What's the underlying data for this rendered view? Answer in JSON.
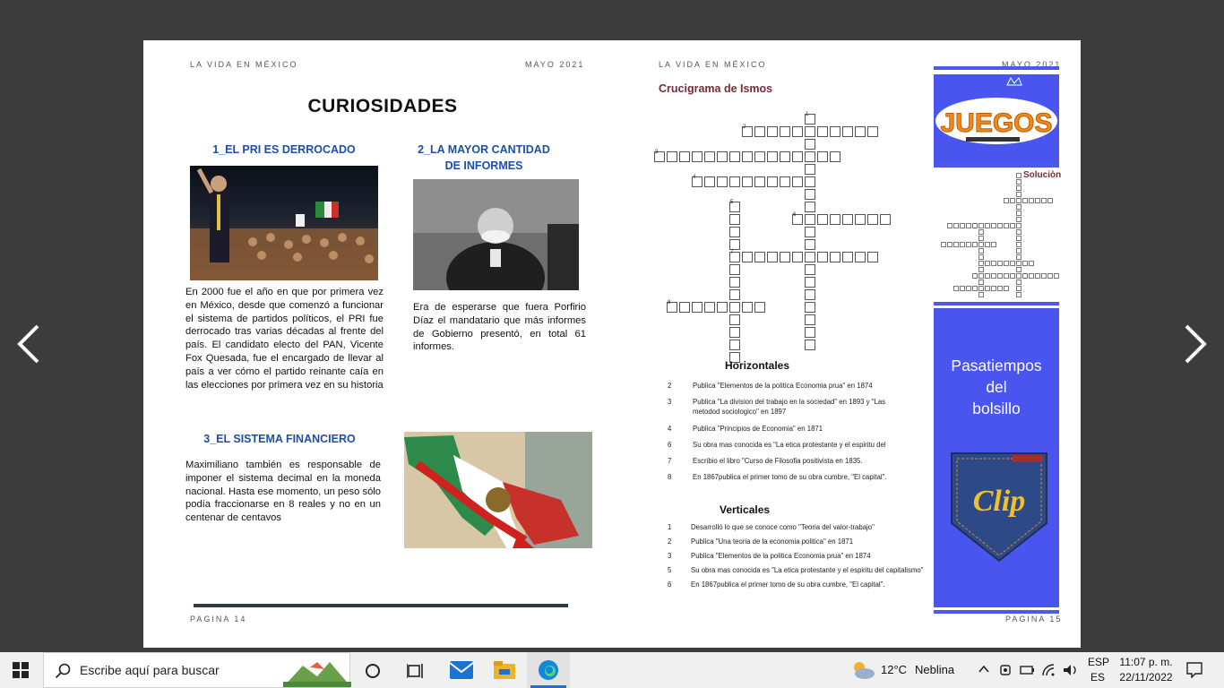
{
  "left_page": {
    "header_left": "LA VIDA EN MÉXICO",
    "header_right": "MAYO 2021",
    "title": "CURIOSIDADES",
    "section1_title": "1_EL PRI ES DERROCADO",
    "section1_text": "En 2000 fue el año en que por primera vez en México, desde que comenzó a funcionar el sistema de partidos políticos, el PRI fue derrocado tras varias décadas al frente del país. El candidato electo del PAN, Vicente Fox Quesada, fue el encargado de llevar al país a ver cómo el partido reinante caía en las elecciones por primera vez en su historia",
    "section2_title": "2_LA MAYOR CANTIDAD DE INFORMES",
    "section2_text": "Era de esperarse que fuera Porfirio Díaz el mandatario que más informes de Gobierno presentó, en total 61 informes.",
    "section3_title": "3_EL SISTEMA FINANCIERO",
    "section3_text": "Maximiliano también es responsable de imponer el sistema decimal en la moneda nacional. Hasta ese momento, un peso sólo podía fraccionarse en 8 reales y no en un centenar de centavos",
    "footer": "PAGINA 14"
  },
  "right_page": {
    "header_left": "LA VIDA EN MÉXICO",
    "header_right": "MAYO 2021",
    "crossword_title": "Crucigrama de Ismos",
    "grid_numbers": [
      "1",
      "2",
      "3",
      "4",
      "5",
      "6",
      "7",
      "8"
    ],
    "horizontales_title": "Horizontales",
    "horizontales": [
      {
        "n": "2",
        "t": "Publica \"Elementos de la politica Economia prua\" en 1874"
      },
      {
        "n": "3",
        "t": "Publica \"La division del trabajo en la sociedad\" en 1893 y \"Las metodod sociologico\" en 1897"
      },
      {
        "n": "4",
        "t": "Publica \"Principios de Economia\" en 1871"
      },
      {
        "n": "6",
        "t": "Su obra mas conocida es \"La etica protestante y el espiritu del"
      },
      {
        "n": "7",
        "t": "Escribio el libro \"Curso de Filosofia positivista en 1835."
      },
      {
        "n": "8",
        "t": "En 1867publica el primer tomo de su obra cumbre, \"El capital\"."
      }
    ],
    "verticales_title": "Verticales",
    "verticales": [
      {
        "n": "1",
        "t": "Desarrolló lo que se conoce como \"Teoria del valor-trabajo\""
      },
      {
        "n": "2",
        "t": "Publica \"Una teoria de la economia politica\" en 1871"
      },
      {
        "n": "3",
        "t": "Publica \"Elementos de la politica Economia prua\" en 1874"
      },
      {
        "n": "5",
        "t": "Su obra mas conocida es \"La etica protestante y el espiritu del capitalismo\""
      },
      {
        "n": "6",
        "t": "En 1867publica el primer tomo de su obra cumbre, \"El capital\"."
      }
    ],
    "juegos_logo": "JUEGOS",
    "solution_label": "Soluciòn",
    "pasatiempos_line1": "Pasatiempos",
    "pasatiempos_line2": "del",
    "pasatiempos_line3": "bolsillo",
    "clip_logo": "Clip",
    "footer": "PAGINA 15"
  },
  "taskbar": {
    "search_placeholder": "Escribe aquí para buscar",
    "weather_temp": "12°C",
    "weather_desc": "Neblina",
    "lang_top": "ESP",
    "lang_bottom": "ES",
    "time": "11:07 p. m.",
    "date": "22/11/2022"
  },
  "colors": {
    "viewer_bg": "#3c3c3c",
    "section_title": "#1d4fa8",
    "crossword_title": "#7a2a38",
    "side_blue": "#4a55f0",
    "taskbar_bg": "#f0f0f0"
  }
}
